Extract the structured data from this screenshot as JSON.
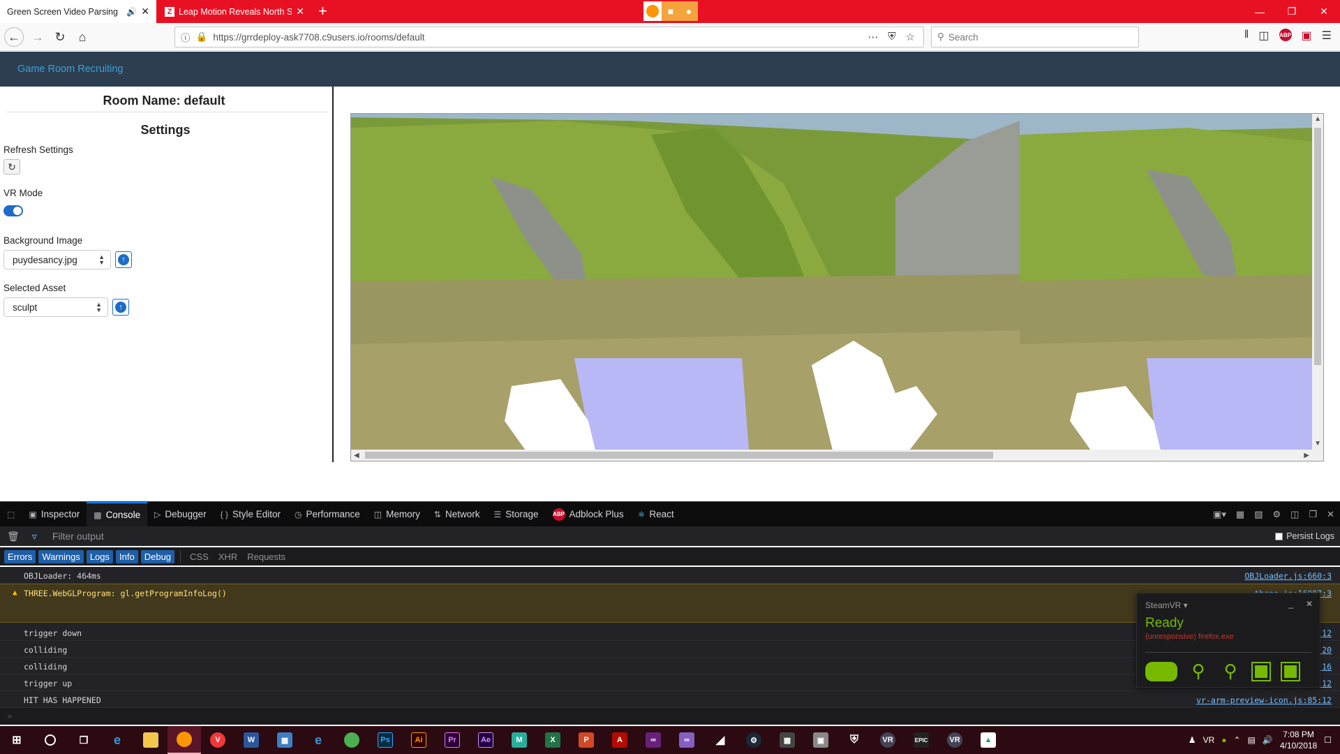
{
  "browser": {
    "tabs": [
      {
        "title": "Green Screen Video Parsing",
        "active": false
      },
      {
        "title": "Leap Motion Reveals North Sta",
        "active": true
      }
    ],
    "url": "https://grrdeploy-ask7708.c9users.io/rooms/default",
    "search_placeholder": "Search",
    "colors": {
      "tab_strip": "#e81123",
      "nav_bg": "#f9f9fa"
    }
  },
  "app": {
    "brand": "Game Room Recruiting",
    "room_name": "Room Name: default",
    "settings_heading": "Settings",
    "refresh_label": "Refresh Settings",
    "vr_mode_label": "VR Mode",
    "vr_mode_on": true,
    "background_label": "Background Image",
    "background_value": "puydesancy.jpg",
    "asset_label": "Selected Asset",
    "asset_value": "sculpt",
    "colors": {
      "navbar": "#2c3e50",
      "brand": "#3d9fd8",
      "accent": "#1e6cc8"
    }
  },
  "devtools": {
    "tabs": [
      {
        "label": "Inspector",
        "icon": "inspector-icon"
      },
      {
        "label": "Console",
        "icon": "console-icon",
        "active": true
      },
      {
        "label": "Debugger",
        "icon": "debugger-icon"
      },
      {
        "label": "Style Editor",
        "icon": "style-editor-icon"
      },
      {
        "label": "Performance",
        "icon": "performance-icon"
      },
      {
        "label": "Memory",
        "icon": "memory-icon"
      },
      {
        "label": "Network",
        "icon": "network-icon"
      },
      {
        "label": "Storage",
        "icon": "storage-icon"
      },
      {
        "label": "Adblock Plus",
        "icon": "abp-icon"
      },
      {
        "label": "React",
        "icon": "react-icon"
      }
    ],
    "filter_placeholder": "Filter output",
    "persist_logs": "Persist Logs",
    "levels": [
      "Errors",
      "Warnings",
      "Logs",
      "Info",
      "Debug"
    ],
    "categories": [
      "CSS",
      "XHR",
      "Requests"
    ],
    "messages": [
      {
        "text": "OBJLoader: 464ms",
        "source": "OBJLoader.js:660:3",
        "type": "log"
      },
      {
        "text": "THREE.WebGLProgram: gl.getProgramInfoLog()",
        "source": "three.js:16987:3",
        "type": "warn"
      },
      {
        "text": "trigger down",
        "source": ":12",
        "type": "log"
      },
      {
        "text": "colliding",
        "source": ":20",
        "type": "log"
      },
      {
        "text": "colliding",
        "source": ":16",
        "type": "log"
      },
      {
        "text": "trigger up",
        "source": ":12",
        "type": "log"
      },
      {
        "text": "HIT HAS HAPPENED",
        "source": "vr-arm-preview-icon.js:85:12",
        "type": "log"
      }
    ]
  },
  "steamvr": {
    "title": "SteamVR ▾",
    "status": "Ready",
    "substatus": "(unresponsive) firefox.exe",
    "color": "#76b900"
  },
  "taskbar": {
    "time": "7:08 PM",
    "date": "4/10/2018",
    "apps": [
      "Edge",
      "Explorer",
      "Firefox",
      "Vivaldi",
      "Word",
      "Network",
      "IE",
      "Chrome",
      "Ps",
      "Ai",
      "Pr",
      "Ae",
      "M",
      "Excel",
      "PowerPoint",
      "Acrobat",
      "Visual Studio",
      "VS",
      "Unity",
      "Steam",
      "Calculator",
      "Remote",
      "Shield",
      "VR",
      "Epic",
      "VR",
      "Drive"
    ]
  }
}
